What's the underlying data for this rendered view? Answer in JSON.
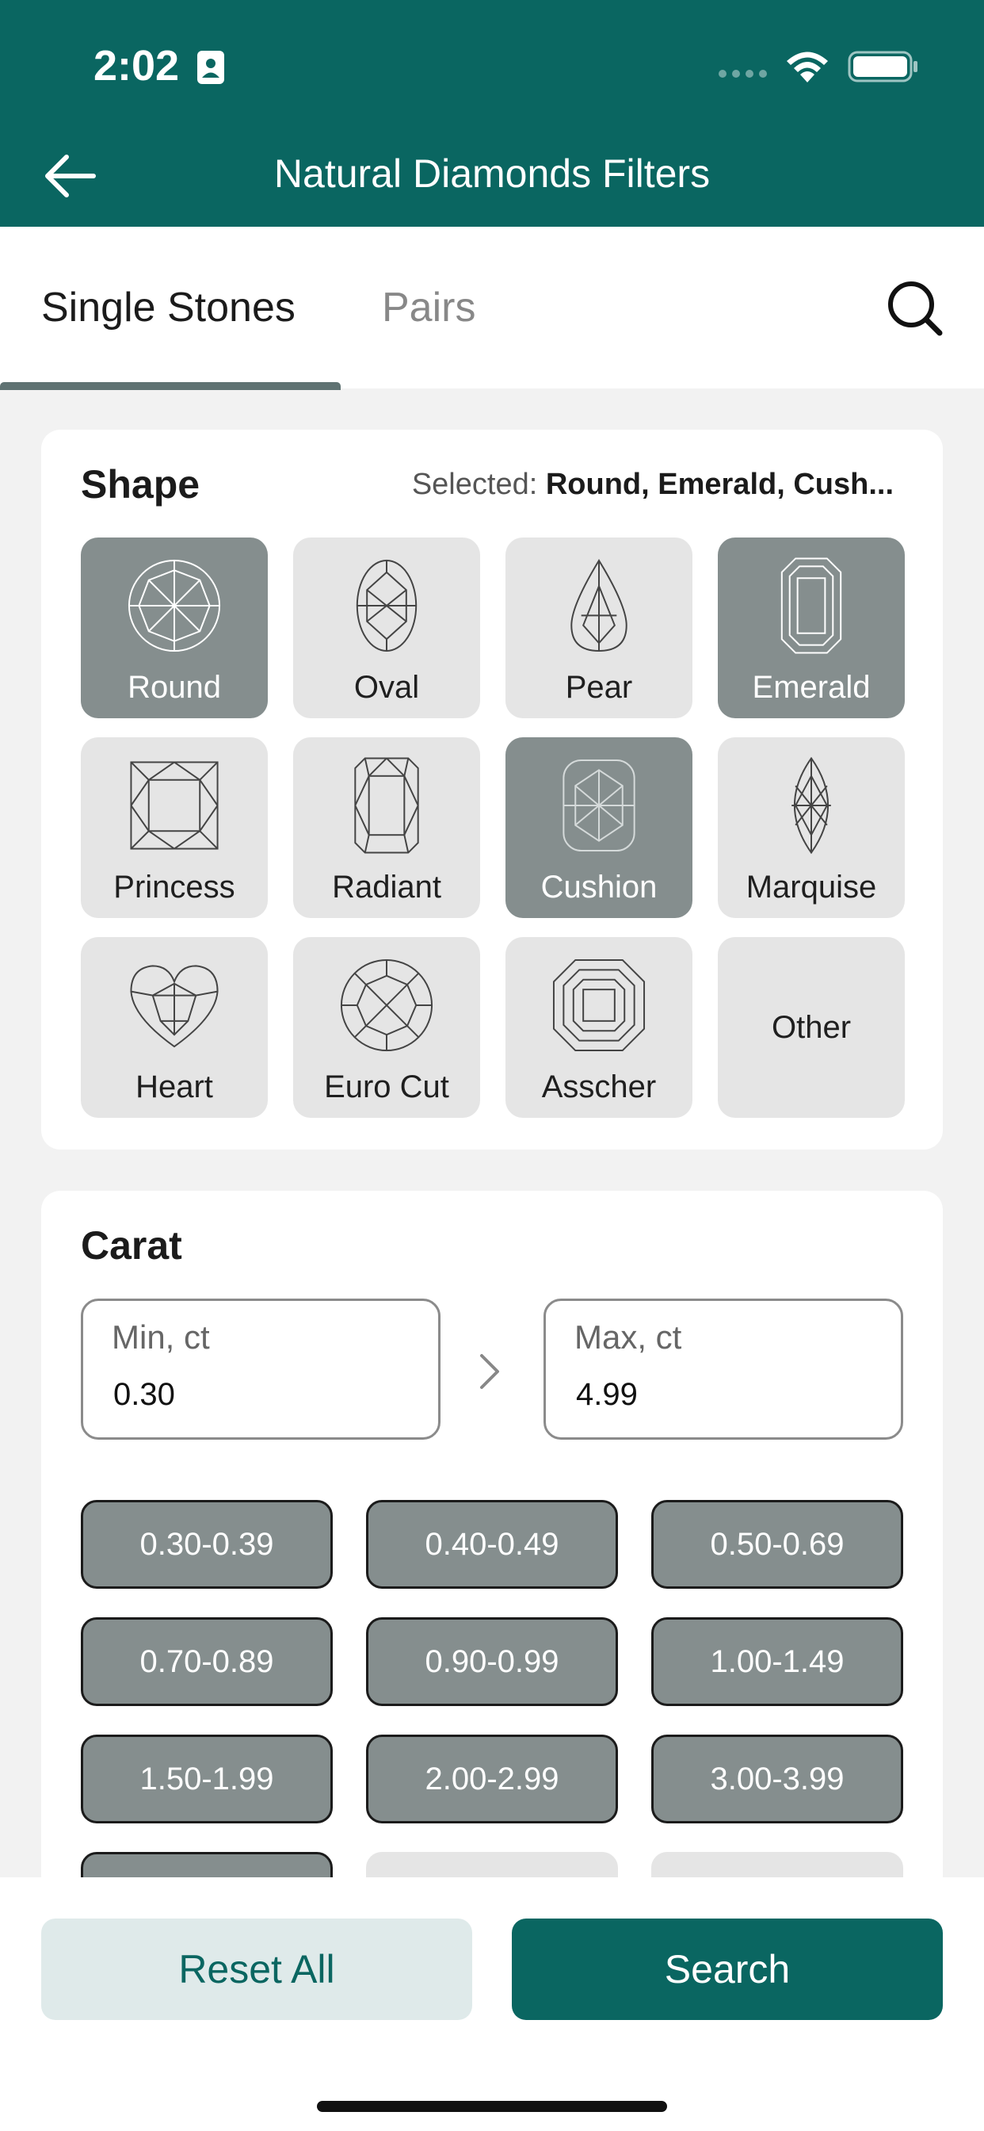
{
  "status_bar": {
    "time": "2:02"
  },
  "header": {
    "title": "Natural Diamonds Filters"
  },
  "tabs": [
    {
      "label": "Single Stones",
      "active": true
    },
    {
      "label": "Pairs",
      "active": false
    }
  ],
  "shape": {
    "title": "Shape",
    "selected_prefix": "Selected:",
    "selected_value": "Round, Emerald, Cush...",
    "items": [
      {
        "label": "Round",
        "icon": "round-diamond-icon",
        "selected": true
      },
      {
        "label": "Oval",
        "icon": "oval-diamond-icon",
        "selected": false
      },
      {
        "label": "Pear",
        "icon": "pear-diamond-icon",
        "selected": false
      },
      {
        "label": "Emerald",
        "icon": "emerald-diamond-icon",
        "selected": true
      },
      {
        "label": "Princess",
        "icon": "princess-diamond-icon",
        "selected": false
      },
      {
        "label": "Radiant",
        "icon": "radiant-diamond-icon",
        "selected": false
      },
      {
        "label": "Cushion",
        "icon": "cushion-diamond-icon",
        "selected": true
      },
      {
        "label": "Marquise",
        "icon": "marquise-diamond-icon",
        "selected": false
      },
      {
        "label": "Heart",
        "icon": "heart-diamond-icon",
        "selected": false
      },
      {
        "label": "Euro Cut",
        "icon": "euro-cut-diamond-icon",
        "selected": false
      },
      {
        "label": "Asscher",
        "icon": "asscher-diamond-icon",
        "selected": false
      },
      {
        "label": "Other",
        "icon": "",
        "selected": false
      }
    ]
  },
  "carat": {
    "title": "Carat",
    "min_label": "Min, ct",
    "min_value": "0.30",
    "max_label": "Max, ct",
    "max_value": "4.99",
    "ranges": [
      {
        "label": "0.30-0.39",
        "selected": true
      },
      {
        "label": "0.40-0.49",
        "selected": true
      },
      {
        "label": "0.50-0.69",
        "selected": true
      },
      {
        "label": "0.70-0.89",
        "selected": true
      },
      {
        "label": "0.90-0.99",
        "selected": true
      },
      {
        "label": "1.00-1.49",
        "selected": true
      },
      {
        "label": "1.50-1.99",
        "selected": true
      },
      {
        "label": "2.00-2.99",
        "selected": true
      },
      {
        "label": "3.00-3.99",
        "selected": true
      },
      {
        "label": "",
        "selected": true
      },
      {
        "label": "",
        "selected": false
      },
      {
        "label": "",
        "selected": false
      }
    ]
  },
  "footer": {
    "reset_label": "Reset All",
    "search_label": "Search"
  },
  "colors": {
    "brand": "#0a6661",
    "selected_tile": "#858e8e",
    "tile": "#e5e5e5"
  }
}
